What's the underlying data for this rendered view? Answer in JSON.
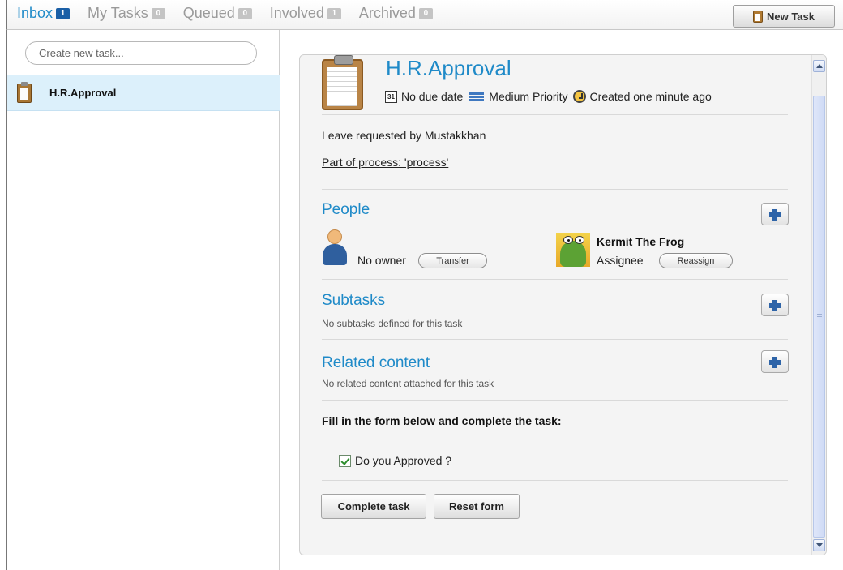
{
  "tabs": [
    {
      "label": "Inbox",
      "count": "1",
      "active": true
    },
    {
      "label": "My Tasks",
      "count": "0",
      "active": false
    },
    {
      "label": "Queued",
      "count": "0",
      "active": false
    },
    {
      "label": "Involved",
      "count": "1",
      "active": false
    },
    {
      "label": "Archived",
      "count": "0",
      "active": false
    }
  ],
  "toolbar": {
    "new_task_label": "New Task",
    "new_task_icon": "clipboard-icon"
  },
  "left_panel": {
    "search_placeholder": "Create new task...",
    "tasks": [
      {
        "label": "H.R.Approval",
        "icon": "clipboard-icon",
        "selected": true
      }
    ]
  },
  "task": {
    "title": "H.R.Approval",
    "icon": "clipboard-icon",
    "due": "No due date",
    "priority": "Medium Priority",
    "created": "Created one minute ago",
    "description": "Leave requested by Mustakkhan",
    "process_link": "Part of process: 'process'"
  },
  "people": {
    "title": "People",
    "owner_text": "No owner",
    "transfer_label": "Transfer",
    "assignee_name": "Kermit The Frog",
    "assignee_role": "Assignee",
    "reassign_label": "Reassign"
  },
  "subtasks": {
    "title": "Subtasks",
    "empty_text": "No subtasks defined for this task"
  },
  "related": {
    "title": "Related content",
    "empty_text": "No related content attached for this task"
  },
  "form": {
    "heading": "Fill in the form below and complete the task:",
    "checkbox_label": "Do you Approved ?",
    "checkbox_checked": true,
    "complete_label": "Complete task",
    "reset_label": "Reset form"
  },
  "colors": {
    "accent": "#1f8ac8",
    "selection": "#dcf0fb",
    "badge_active": "#1a5fa6",
    "badge_inactive": "#c4c4c4"
  }
}
